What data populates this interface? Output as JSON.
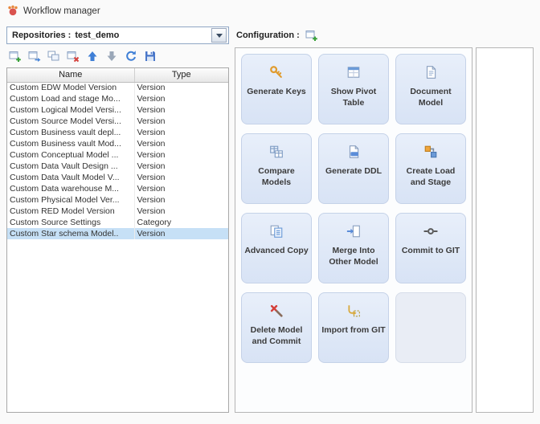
{
  "window": {
    "title": "Workflow manager"
  },
  "left_panel": {
    "repositories_label": "Repositories :",
    "repository_value": "test_demo",
    "toolbar": [
      {
        "name": "add-repository",
        "icon": "add-table-icon"
      },
      {
        "name": "copy-repository",
        "icon": "copy-table-icon"
      },
      {
        "name": "duplicate-repository",
        "icon": "duplicate-icon"
      },
      {
        "name": "remove-repository",
        "icon": "remove-table-icon"
      },
      {
        "name": "move-up",
        "icon": "arrow-up-icon"
      },
      {
        "name": "move-down",
        "icon": "arrow-down-icon"
      },
      {
        "name": "refresh",
        "icon": "refresh-icon"
      },
      {
        "name": "save",
        "icon": "save-icon"
      }
    ],
    "table": {
      "columns": [
        "Name",
        "Type"
      ],
      "selected_index": 13,
      "rows": [
        [
          "Custom EDW Model Version",
          "Version"
        ],
        [
          "Custom Load and stage Mo...",
          "Version"
        ],
        [
          "Custom Logical Model Versi...",
          "Version"
        ],
        [
          "Custom Source Model Versi...",
          "Version"
        ],
        [
          "Custom Business vault depl...",
          "Version"
        ],
        [
          "Custom Business vault Mod...",
          "Version"
        ],
        [
          "Custom Conceptual Model ...",
          "Version"
        ],
        [
          "Custom Data Vault Design ...",
          "Version"
        ],
        [
          "Custom Data Vault Model V...",
          "Version"
        ],
        [
          "Custom Data warehouse M...",
          "Version"
        ],
        [
          "Custom Physical Model Ver...",
          "Version"
        ],
        [
          "Custom RED Model Version",
          "Version"
        ],
        [
          "Custom Source Settings",
          "Category"
        ],
        [
          "Custom Star schema Model..",
          "Version"
        ]
      ]
    }
  },
  "right_panel": {
    "configuration_label": "Configuration :",
    "configuration_icon": "add-config-icon",
    "tiles": [
      {
        "label": "Generate Keys",
        "icon": "key-icon"
      },
      {
        "label": "Show Pivot Table",
        "icon": "pivot-table-icon"
      },
      {
        "label": "Document Model",
        "icon": "document-icon"
      },
      {
        "label": "Compare Models",
        "icon": "compare-models-icon"
      },
      {
        "label": "Generate DDL",
        "icon": "generate-ddl-icon"
      },
      {
        "label": "Create Load and Stage",
        "icon": "load-stage-icon"
      },
      {
        "label": "Advanced Copy",
        "icon": "advanced-copy-icon"
      },
      {
        "label": "Merge Into Other Model",
        "icon": "merge-icon"
      },
      {
        "label": "Commit to GIT",
        "icon": "commit-git-icon"
      },
      {
        "label": "Delete Model and Commit",
        "icon": "delete-commit-icon"
      },
      {
        "label": "Import from GIT",
        "icon": "import-git-icon"
      },
      {
        "label": "",
        "icon": ""
      }
    ]
  }
}
